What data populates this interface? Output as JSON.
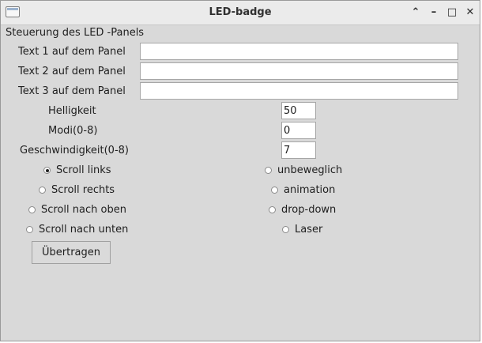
{
  "window": {
    "title": "LED-badge",
    "controls": {
      "minimize": "–",
      "maximize": "□",
      "close": "✕",
      "rollup": "⌃"
    }
  },
  "heading": "Steuerung des LED -Panels",
  "text_fields": [
    {
      "label": "Text 1  auf dem Panel",
      "value": ""
    },
    {
      "label": "Text 2  auf dem Panel",
      "value": ""
    },
    {
      "label": "Text 3  auf dem Panel",
      "value": ""
    }
  ],
  "number_fields": [
    {
      "label": "Helligkeit",
      "value": "50"
    },
    {
      "label": "Modi(0-8)",
      "value": "0"
    },
    {
      "label": "Geschwindigkeit(0-8)",
      "value": "7"
    }
  ],
  "radios_left": [
    {
      "label": "Scroll links",
      "checked": true
    },
    {
      "label": "Scroll rechts",
      "checked": false
    },
    {
      "label": "Scroll nach oben",
      "checked": false
    },
    {
      "label": "Scroll nach unten",
      "checked": false
    }
  ],
  "radios_right": [
    {
      "label": "unbeweglich",
      "checked": false
    },
    {
      "label": "animation",
      "checked": false
    },
    {
      "label": "drop-down",
      "checked": false
    },
    {
      "label": "Laser",
      "checked": false
    }
  ],
  "submit_label": "Übertragen"
}
